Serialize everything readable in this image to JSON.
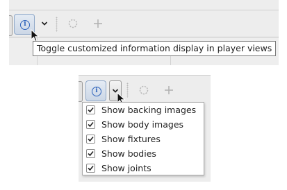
{
  "top_view": {
    "tooltip": "Toggle customized information display in player views",
    "icons": [
      "info-icon",
      "chevron-down-icon",
      "loading-circle-icon",
      "plus-icon"
    ]
  },
  "bottom_view": {
    "icons": [
      "info-icon",
      "chevron-down-icon",
      "loading-circle-icon",
      "plus-icon"
    ],
    "menu_items": [
      {
        "label": "Show backing images",
        "checked": true
      },
      {
        "label": "Show body images",
        "checked": true
      },
      {
        "label": "Show fixtures",
        "checked": true
      },
      {
        "label": "Show bodies",
        "checked": true
      },
      {
        "label": "Show joints",
        "checked": true
      }
    ]
  },
  "colors": {
    "toolbar_bg": "#ededed",
    "info_blue": "#2d63bb",
    "tooltip_border": "#767676",
    "menu_border": "#a9a9a9"
  }
}
